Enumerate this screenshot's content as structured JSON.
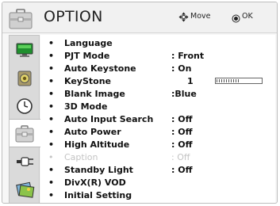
{
  "header": {
    "title": "OPTION",
    "move_hint": "Move",
    "ok_hint": "OK",
    "icon": "briefcase-icon"
  },
  "sidebar": {
    "items": [
      {
        "icon": "monitor-icon",
        "selected": false
      },
      {
        "icon": "speaker-icon",
        "selected": false
      },
      {
        "icon": "clock-icon",
        "selected": false
      },
      {
        "icon": "briefcase-icon",
        "selected": true
      },
      {
        "icon": "plug-icon",
        "selected": false
      },
      {
        "icon": "media-icon",
        "selected": false
      }
    ]
  },
  "menu": {
    "items": [
      {
        "label": "Language",
        "value": ""
      },
      {
        "label": "PJT Mode",
        "value": ": Front"
      },
      {
        "label": "Auto Keystone",
        "value": ": On"
      },
      {
        "label": "KeyStone",
        "value": "1",
        "level": 0.5
      },
      {
        "label": "Blank Image",
        "value": ":Blue"
      },
      {
        "label": "3D Mode",
        "value": ""
      },
      {
        "label": "Auto Input Search",
        "value": ": Off"
      },
      {
        "label": "Auto Power",
        "value": ": Off"
      },
      {
        "label": "High Altitude",
        "value": ": Off"
      },
      {
        "label": "Caption",
        "value": ": Off",
        "disabled": true
      },
      {
        "label": "Standby Light",
        "value": ": Off"
      },
      {
        "label": "DivX(R) VOD",
        "value": ""
      },
      {
        "label": "Initial Setting",
        "value": ""
      }
    ]
  },
  "colors": {
    "header_bg": "#f1f1f1",
    "sidebar_bg": "#dadada",
    "disabled_text": "#c4c4c4"
  }
}
